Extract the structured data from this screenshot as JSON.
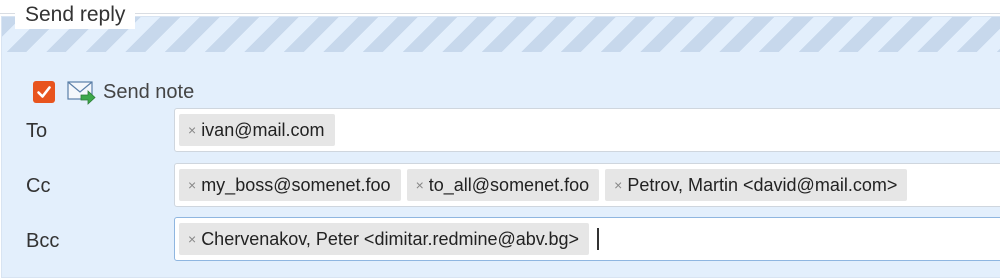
{
  "fieldset": {
    "legend": "Send reply",
    "send_note": {
      "checked": true,
      "label": "Send note",
      "icon": "mail-forward-icon"
    },
    "fields": [
      {
        "key": "to",
        "label": "To",
        "tokens": [
          "ivan@mail.com"
        ]
      },
      {
        "key": "cc",
        "label": "Cc",
        "tokens": [
          "my_boss@somenet.foo",
          "to_all@somenet.foo",
          "Petrov, Martin <david@mail.com>"
        ]
      },
      {
        "key": "bcc",
        "label": "Bcc",
        "tokens": [
          "Chervenakov, Peter <dimitar.redmine@abv.bg>"
        ]
      }
    ],
    "remove_glyph": "×"
  },
  "colors": {
    "panel_bg": "#e3effc",
    "stripe": "#c7d8ec",
    "checkbox_accent": "#e8541e",
    "token_bg": "#e6e6e6"
  }
}
